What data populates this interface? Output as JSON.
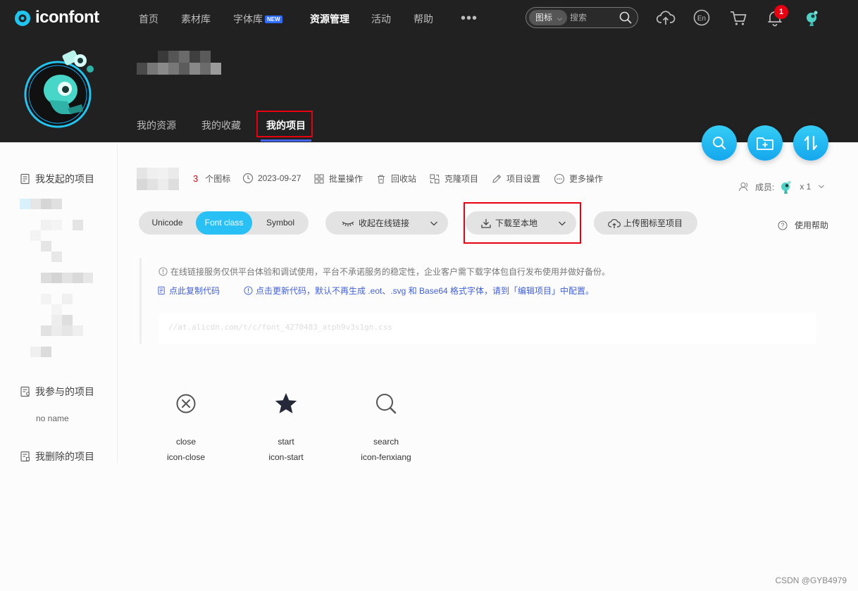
{
  "brand": {
    "name": "iconfont"
  },
  "nav": {
    "items": [
      {
        "label": "首页"
      },
      {
        "label": "素材库"
      },
      {
        "label": "字体库",
        "badge": "NEW"
      },
      {
        "label": "资源管理"
      },
      {
        "label": "活动"
      },
      {
        "label": "帮助"
      }
    ],
    "more": "•••",
    "search": {
      "category": "图标",
      "placeholder": "搜索"
    },
    "notifications_count": "1"
  },
  "profile": {
    "tabs": [
      {
        "label": "我的资源"
      },
      {
        "label": "我的收藏"
      },
      {
        "label": "我的项目"
      }
    ]
  },
  "sidebar": {
    "created": "我发起的项目",
    "joined": "我参与的项目",
    "joined_item": "no name",
    "deleted": "我删除的项目"
  },
  "project": {
    "icon_count": "3",
    "icon_count_label": "个图标",
    "date": "2023-09-27",
    "actions": [
      {
        "label": "批量操作"
      },
      {
        "label": "回收站"
      },
      {
        "label": "克隆项目"
      },
      {
        "label": "项目设置"
      },
      {
        "label": "更多操作"
      }
    ],
    "members_label": "成员:",
    "members_count": "x 1"
  },
  "toolbar": {
    "modes": [
      {
        "label": "Unicode"
      },
      {
        "label": "Font class",
        "active": true
      },
      {
        "label": "Symbol"
      }
    ],
    "collapse_link": "收起在线链接",
    "download": "下载至本地",
    "upload": "上传图标至项目",
    "help": "使用帮助"
  },
  "notice": {
    "warning": "在线链接服务仅供平台体验和调试使用，平台不承诺服务的稳定性，企业客户需下载字体包自行发布使用并做好备份。",
    "copy_code": "点此复制代码",
    "update_code": "点击更新代码，默认不再生成 .eot、.svg 和 Base64 格式字体，请到「编辑项目」中配置。",
    "code_url": "//at.alicdn.com/t/c/font_4270483_atph9v3s1gn.css"
  },
  "icons": [
    {
      "name": "close",
      "class": "icon-close",
      "glyph": "close-circle-icon"
    },
    {
      "name": "start",
      "class": "icon-start",
      "glyph": "star-icon"
    },
    {
      "name": "search",
      "class": "icon-fenxiang",
      "glyph": "search-icon"
    }
  ],
  "colors": {
    "nav_bg": "#212121",
    "accent": "#29c0f5",
    "highlight_red": "#e60012",
    "link_blue": "#4361d3"
  },
  "watermark": "CSDN @GYB4979"
}
